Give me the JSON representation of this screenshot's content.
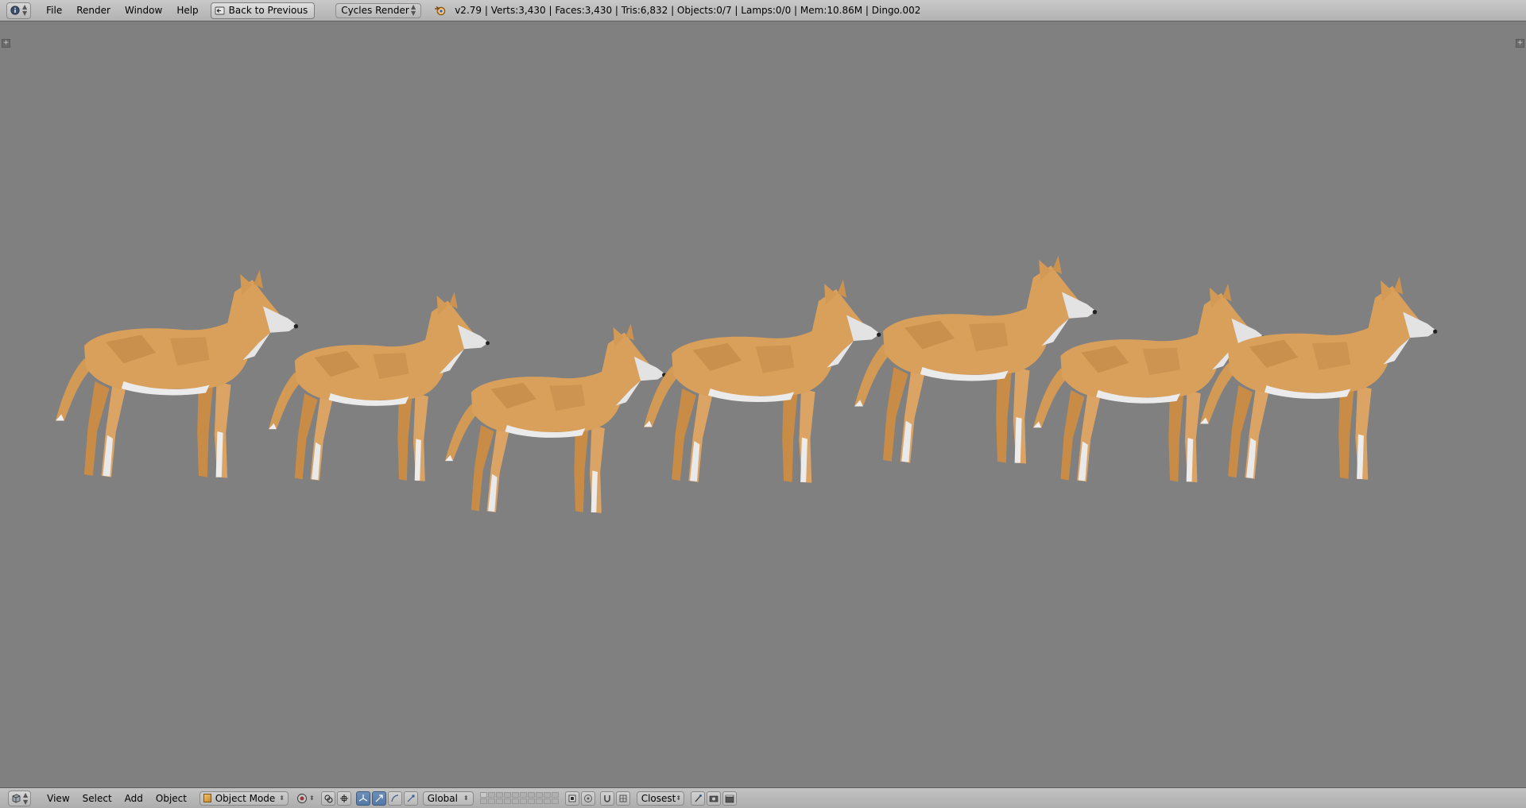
{
  "top_menu": {
    "editor_icon": "info-icon",
    "items": [
      {
        "label": "File"
      },
      {
        "label": "Render"
      },
      {
        "label": "Window"
      },
      {
        "label": "Help"
      }
    ],
    "back_button": "Back to Previous",
    "render_engine": "Cycles Render",
    "stats": "v2.79 | Verts:3,430 | Faces:3,430 | Tris:6,832 | Objects:0/7 | Lamps:0/0 | Mem:10.86M | Dingo.002"
  },
  "viewport": {
    "background_color": "#808080",
    "model_color": "#d9a05c",
    "belly_color": "#e6e6e6",
    "dingo_count": 7
  },
  "bottom_header": {
    "editor_icon": "3d-view-icon",
    "menu": [
      {
        "label": "View"
      },
      {
        "label": "Select"
      },
      {
        "label": "Add"
      },
      {
        "label": "Object"
      }
    ],
    "mode": "Object Mode",
    "orientation": "Global",
    "snap_target": "Closest"
  }
}
